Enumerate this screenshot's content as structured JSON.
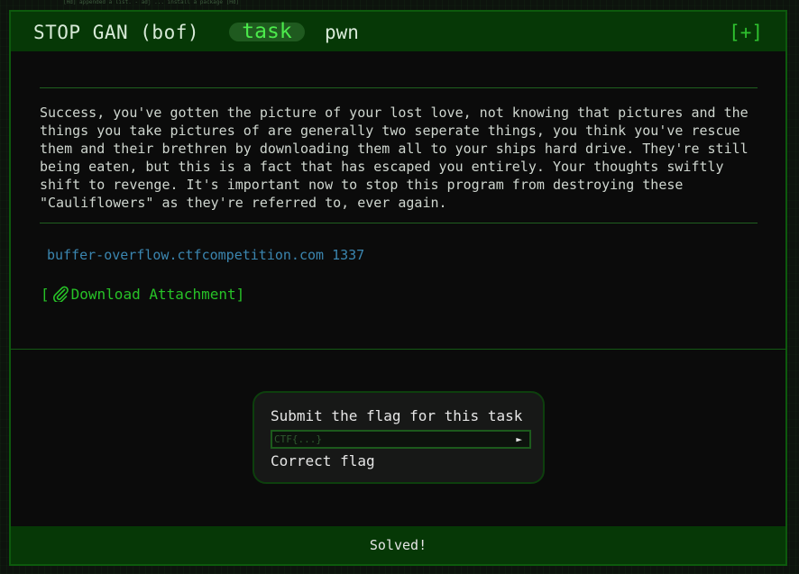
{
  "background_text": "[Hd] appended a list. - adj ...  install a package [Hd]",
  "task": {
    "name": "STOP GAN (bof)",
    "badge": "task",
    "category": "pwn",
    "expand_label": "[+]"
  },
  "description": "Success, you've gotten the picture of your lost love, not knowing that pictures and the things you take pictures of are generally two seperate things, you think you've rescue them and their brethren by downloading them all to your ships hard drive. They're still being eaten, but this is a fact that has escaped you entirely. Your thoughts swiftly shift to revenge. It's important now to stop this program from destroying these \"Cauliflowers\" as they're referred to, ever again.",
  "host": "buffer-overflow.ctfcompetition.com 1337",
  "attachment": {
    "open_bracket": "[",
    "icon": "paperclip-icon",
    "label": "Download Attachment",
    "close_bracket": "]"
  },
  "submit": {
    "title": "Submit the flag for this task",
    "placeholder": "CTF{...}",
    "value": "",
    "button_glyph": "►",
    "status": "Correct flag"
  },
  "footer": {
    "status": "Solved!"
  },
  "colors": {
    "accent_green": "#27c227",
    "header_bg": "#063806",
    "link_blue": "#3b86b0"
  }
}
